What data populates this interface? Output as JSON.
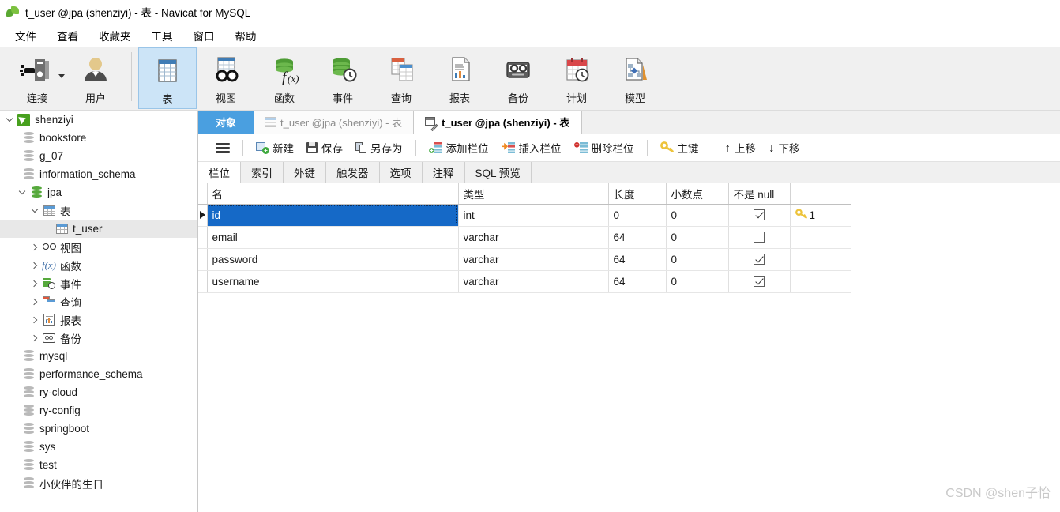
{
  "window": {
    "title": "t_user @jpa (shenziyi) - 表 - Navicat for MySQL",
    "logo_icon": "navicat-leaf-icon"
  },
  "menubar": {
    "items": [
      {
        "label": "文件"
      },
      {
        "label": "查看"
      },
      {
        "label": "收藏夹"
      },
      {
        "label": "工具"
      },
      {
        "label": "窗口"
      },
      {
        "label": "帮助"
      }
    ]
  },
  "ribbon": {
    "buttons": [
      {
        "label": "连接",
        "icon": "connection-icon",
        "selected": false,
        "has_dropdown": true
      },
      {
        "label": "用户",
        "icon": "user-icon",
        "selected": false,
        "has_dropdown": false
      },
      {
        "label": "表",
        "icon": "table-icon",
        "selected": true,
        "has_dropdown": false
      },
      {
        "label": "视图",
        "icon": "view-glasses-icon",
        "selected": false,
        "has_dropdown": false
      },
      {
        "label": "函数",
        "icon": "function-fx-icon",
        "selected": false,
        "has_dropdown": false
      },
      {
        "label": "事件",
        "icon": "event-clock-icon",
        "selected": false,
        "has_dropdown": false
      },
      {
        "label": "查询",
        "icon": "query-icon",
        "selected": false,
        "has_dropdown": false
      },
      {
        "label": "报表",
        "icon": "report-icon",
        "selected": false,
        "has_dropdown": false
      },
      {
        "label": "备份",
        "icon": "backup-tape-icon",
        "selected": false,
        "has_dropdown": false
      },
      {
        "label": "计划",
        "icon": "schedule-calendar-icon",
        "selected": false,
        "has_dropdown": false
      },
      {
        "label": "模型",
        "icon": "model-diagram-icon",
        "selected": false,
        "has_dropdown": false
      }
    ]
  },
  "sidebar": {
    "items": [
      {
        "label": "shenziyi",
        "indent": 0,
        "icon": "connection-icon",
        "twisty": "open",
        "selected": false
      },
      {
        "label": "bookstore",
        "indent": 1,
        "icon": "database-icon",
        "twisty": "none",
        "selected": false
      },
      {
        "label": "g_07",
        "indent": 1,
        "icon": "database-icon",
        "twisty": "none",
        "selected": false
      },
      {
        "label": "information_schema",
        "indent": 1,
        "icon": "database-icon",
        "twisty": "none",
        "selected": false
      },
      {
        "label": "jpa",
        "indent": 1,
        "icon": "database-open-icon",
        "twisty": "open",
        "selected": false
      },
      {
        "label": "表",
        "indent": 2,
        "icon": "table-icon",
        "twisty": "open",
        "selected": false
      },
      {
        "label": "t_user",
        "indent": 3,
        "icon": "table-icon",
        "twisty": "none",
        "selected": true
      },
      {
        "label": "视图",
        "indent": 2,
        "icon": "view-glasses-icon",
        "twisty": "closed",
        "selected": false
      },
      {
        "label": "函数",
        "indent": 2,
        "icon": "function-fx-icon",
        "twisty": "closed",
        "selected": false
      },
      {
        "label": "事件",
        "indent": 2,
        "icon": "event-clock-icon",
        "twisty": "closed",
        "selected": false
      },
      {
        "label": "查询",
        "indent": 2,
        "icon": "query-icon",
        "twisty": "closed",
        "selected": false
      },
      {
        "label": "报表",
        "indent": 2,
        "icon": "report-icon",
        "twisty": "closed",
        "selected": false
      },
      {
        "label": "备份",
        "indent": 2,
        "icon": "backup-tape-icon",
        "twisty": "closed",
        "selected": false
      },
      {
        "label": "mysql",
        "indent": 1,
        "icon": "database-icon",
        "twisty": "none",
        "selected": false
      },
      {
        "label": "performance_schema",
        "indent": 1,
        "icon": "database-icon",
        "twisty": "none",
        "selected": false
      },
      {
        "label": "ry-cloud",
        "indent": 1,
        "icon": "database-icon",
        "twisty": "none",
        "selected": false
      },
      {
        "label": "ry-config",
        "indent": 1,
        "icon": "database-icon",
        "twisty": "none",
        "selected": false
      },
      {
        "label": "springboot",
        "indent": 1,
        "icon": "database-icon",
        "twisty": "none",
        "selected": false
      },
      {
        "label": "sys",
        "indent": 1,
        "icon": "database-icon",
        "twisty": "none",
        "selected": false
      },
      {
        "label": "test",
        "indent": 1,
        "icon": "database-icon",
        "twisty": "none",
        "selected": false
      },
      {
        "label": "小伙伴的生日",
        "indent": 1,
        "icon": "database-icon",
        "twisty": "none",
        "selected": false
      }
    ]
  },
  "doc_tabs": [
    {
      "label": "对象",
      "icon": "none",
      "state": "objects"
    },
    {
      "label": "t_user @jpa (shenziyi) - 表",
      "icon": "table-icon",
      "state": "inactive"
    },
    {
      "label": "t_user @jpa (shenziyi) - 表",
      "icon": "design-table-icon",
      "state": "active"
    }
  ],
  "action_toolbar": {
    "menu_icon": "hamburger-menu-icon",
    "buttons": [
      {
        "label": "新建",
        "icon": "new-record-icon"
      },
      {
        "label": "保存",
        "icon": "save-floppy-icon"
      },
      {
        "label": "另存为",
        "icon": "save-as-copy-icon"
      },
      {
        "label": "添加栏位",
        "icon": "add-field-icon"
      },
      {
        "label": "插入栏位",
        "icon": "insert-field-icon"
      },
      {
        "label": "删除栏位",
        "icon": "delete-field-icon"
      },
      {
        "label": "主键",
        "icon": "primary-key-icon"
      },
      {
        "label": "上移",
        "icon": "move-up-arrow-icon"
      },
      {
        "label": "下移",
        "icon": "move-down-arrow-icon"
      }
    ]
  },
  "sub_tabs": [
    {
      "label": "栏位",
      "active": true
    },
    {
      "label": "索引",
      "active": false
    },
    {
      "label": "外键",
      "active": false
    },
    {
      "label": "触发器",
      "active": false
    },
    {
      "label": "选项",
      "active": false
    },
    {
      "label": "注释",
      "active": false
    },
    {
      "label": "SQL 预览",
      "active": false
    }
  ],
  "grid": {
    "columns": [
      "名",
      "类型",
      "长度",
      "小数点",
      "不是 null",
      ""
    ],
    "rows": [
      {
        "name": "id",
        "type": "int",
        "length": "0",
        "decimals": "0",
        "not_null": true,
        "key": "1",
        "selected": true
      },
      {
        "name": "email",
        "type": "varchar",
        "length": "64",
        "decimals": "0",
        "not_null": false,
        "key": "",
        "selected": false
      },
      {
        "name": "password",
        "type": "varchar",
        "length": "64",
        "decimals": "0",
        "not_null": true,
        "key": "",
        "selected": false
      },
      {
        "name": "username",
        "type": "varchar",
        "length": "64",
        "decimals": "0",
        "not_null": true,
        "key": "",
        "selected": false
      }
    ]
  },
  "watermark": {
    "text": "CSDN @shen子怡"
  },
  "colors": {
    "accent_blue": "#1569c7",
    "tab_blue": "#4a9fe0",
    "ribbon_selected": "#cce4f7",
    "chrome_gray": "#f0f0f0",
    "green": "#56a93c",
    "key_yellow": "#f2c23c"
  }
}
